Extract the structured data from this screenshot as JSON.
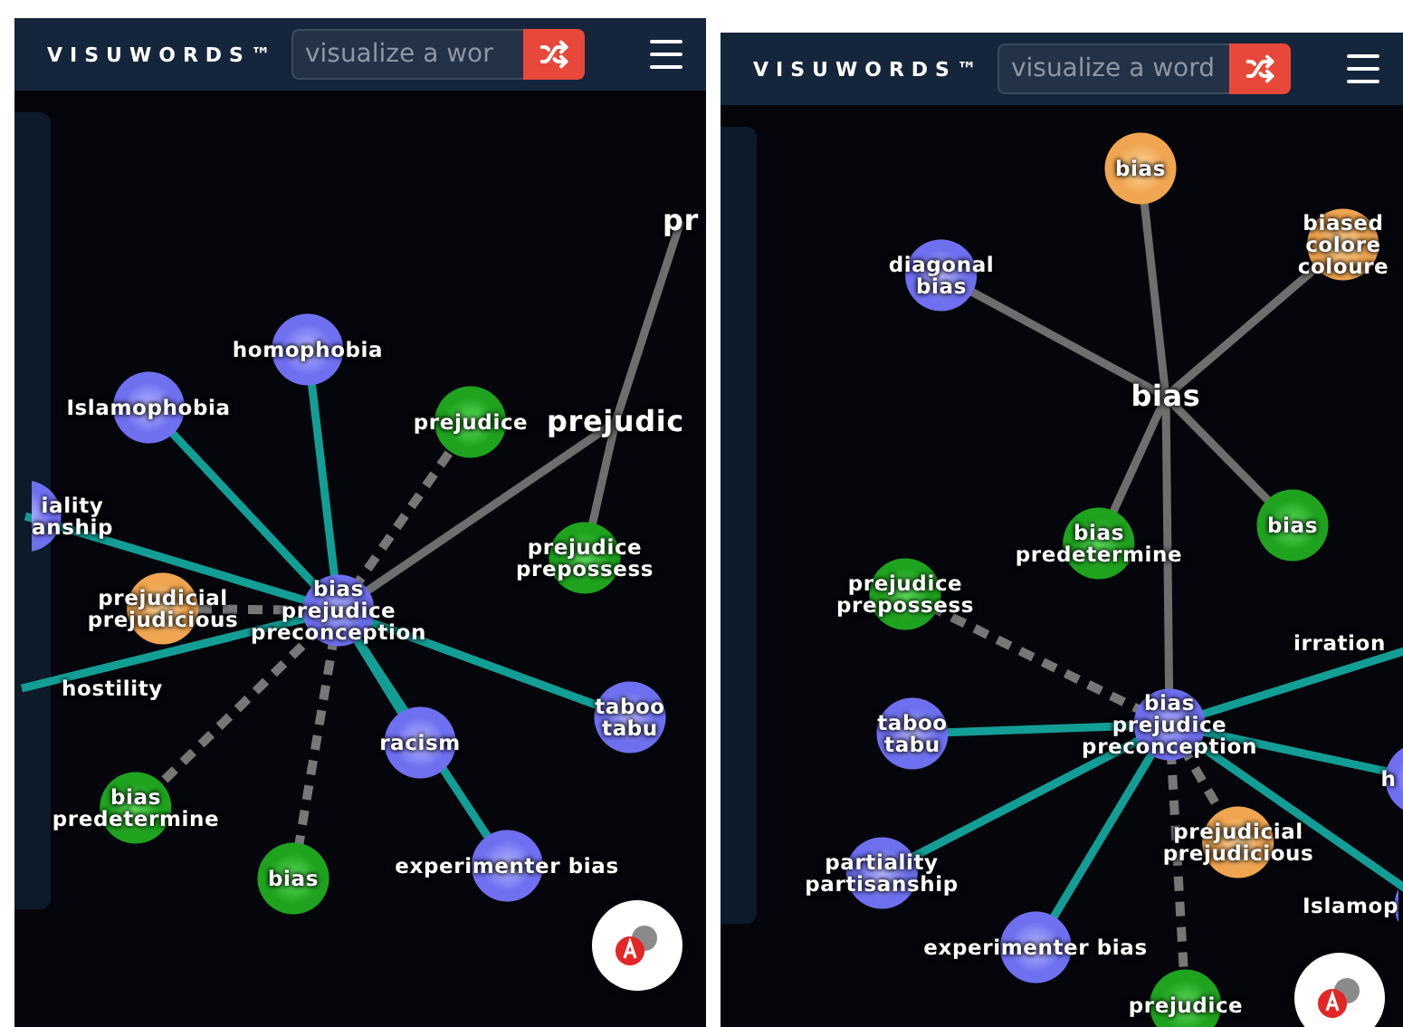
{
  "panels": [
    {
      "logo": "VISUWORDS™",
      "search": {
        "placeholder": "visualize a wor"
      },
      "graph": [
        {
          "label": "bias\nprejudice\npreconception",
          "kind": "noun",
          "children": [
            {
              "label": "homophobia",
              "kind": "noun",
              "color": "#139e95",
              "dashed": false
            },
            {
              "label": "Islamophobia",
              "kind": "noun",
              "color": "#139e95",
              "dashed": false
            },
            {
              "label": "iality\nanship",
              "kind": "noun",
              "color": "#139e95",
              "dashed": false
            },
            {
              "label": "prejudicial\nprejudicious",
              "kind": "adjective",
              "color": "#777777",
              "dashed": true
            },
            {
              "label": "hostility",
              "kind": "noun",
              "color": "#139e95",
              "dashed": false
            },
            {
              "label": "bias\npredetermine",
              "kind": "verb",
              "color": "#777777",
              "dashed": true
            },
            {
              "label": "bias",
              "kind": "verb",
              "color": "#777777",
              "dashed": true
            },
            {
              "label": "racism",
              "kind": "noun",
              "color": "#139e95",
              "dashed": false
            },
            {
              "label": "experimenter bias",
              "kind": "noun",
              "color": "#139e95",
              "dashed": false
            },
            {
              "label": "taboo\ntabu",
              "kind": "noun",
              "color": "#139e95",
              "dashed": false
            },
            {
              "label": "prejudice",
              "kind": "verb",
              "color": "#777777",
              "dashed": true
            },
            {
              "label": "prejudic",
              "kind": "word",
              "color": "#6e6e6e",
              "dashed": false,
              "children": [
                {
                  "label": "pr",
                  "kind": "word",
                  "color": "#6e6e6e",
                  "dashed": false
                },
                {
                  "label": "prejudice\nprepossess",
                  "kind": "verb",
                  "color": "#6e6e6e",
                  "dashed": false
                }
              ]
            }
          ]
        }
      ]
    },
    {
      "logo": "VISUWORDS™",
      "search": {
        "placeholder": "visualize a word"
      },
      "graph": [
        {
          "label": "bias",
          "kind": "word",
          "children": [
            {
              "label": "bias",
              "kind": "adjective",
              "color": "#6e6e6e",
              "dashed": false
            },
            {
              "label": "diagonal\nbias",
              "kind": "noun",
              "color": "#6e6e6e",
              "dashed": false
            },
            {
              "label": "biased\ncolore\ncoloure",
              "kind": "adjective",
              "color": "#6e6e6e",
              "dashed": false
            },
            {
              "label": "bias\npredetermine",
              "kind": "verb",
              "color": "#6e6e6e",
              "dashed": false
            },
            {
              "label": "bias",
              "kind": "verb",
              "color": "#6e6e6e",
              "dashed": false
            },
            {
              "label": "bias\nprejudice\npreconception",
              "kind": "noun",
              "color": "#6e6e6e",
              "dashed": false,
              "children": [
                {
                  "label": "prejudice\nprepossess",
                  "kind": "verb",
                  "color": "#777777",
                  "dashed": true
                },
                {
                  "label": "irration",
                  "kind": "noun",
                  "color": "#139e95",
                  "dashed": false
                },
                {
                  "label": "h",
                  "kind": "noun",
                  "color": "#139e95",
                  "dashed": false
                },
                {
                  "label": "taboo\ntabu",
                  "kind": "noun",
                  "color": "#139e95",
                  "dashed": false
                },
                {
                  "label": "partiality\npartisanship",
                  "kind": "noun",
                  "color": "#139e95",
                  "dashed": false
                },
                {
                  "label": "experimenter bias",
                  "kind": "noun",
                  "color": "#139e95",
                  "dashed": false
                },
                {
                  "label": "prejudicial\nprejudicious",
                  "kind": "adjective",
                  "color": "#777777",
                  "dashed": true
                },
                {
                  "label": "Islamop",
                  "kind": "noun",
                  "color": "#139e95",
                  "dashed": false
                },
                {
                  "label": "prejudice",
                  "kind": "verb",
                  "color": "#777777",
                  "dashed": true
                }
              ]
            }
          ]
        }
      ]
    }
  ]
}
